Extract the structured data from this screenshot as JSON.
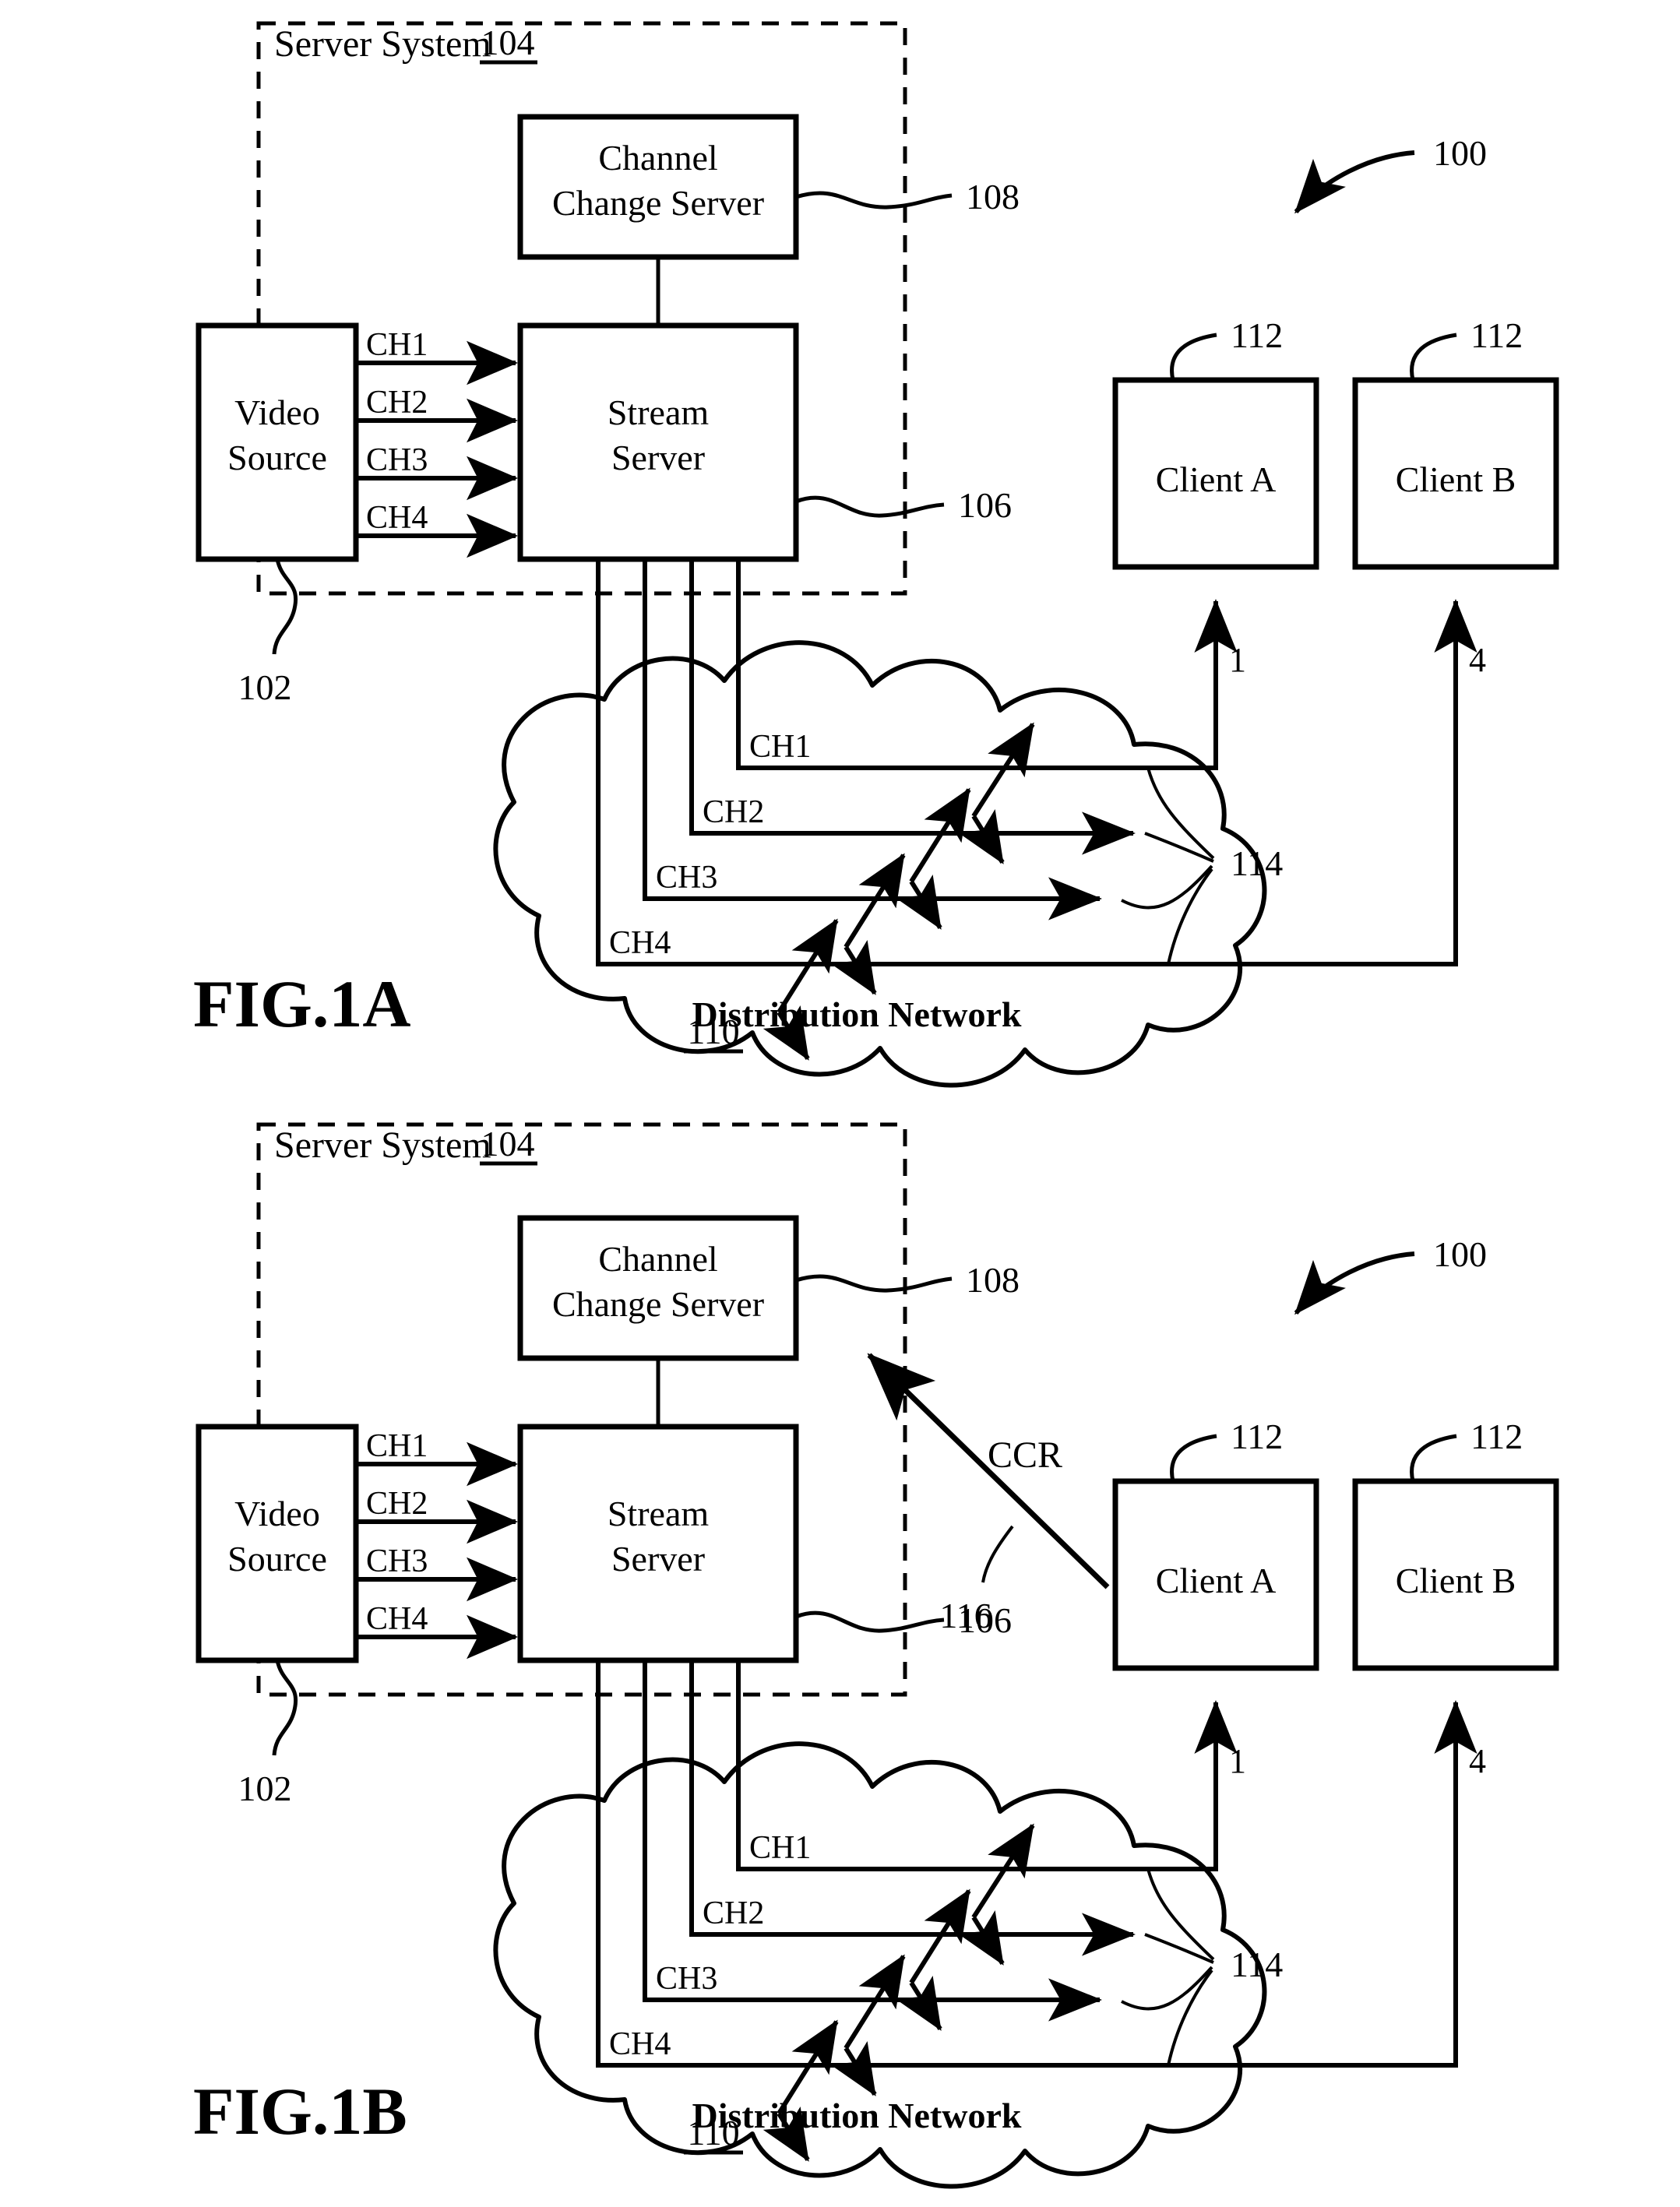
{
  "figures": [
    {
      "id": "fig1a",
      "caption": "FIG.1A",
      "system_ref": "100",
      "server_system": {
        "label": "Server System",
        "ref": "104",
        "channel_change_server": {
          "line1": "Channel",
          "line2": "Change Server",
          "ref": "108"
        },
        "stream_server": {
          "line1": "Stream",
          "line2": "Server",
          "ref": "106"
        }
      },
      "video_source": {
        "line1": "Video",
        "line2": "Source",
        "ref": "102"
      },
      "input_channels": [
        "CH1",
        "CH2",
        "CH3",
        "CH4"
      ],
      "network": {
        "label": "Distribution Network",
        "ref": "110",
        "stream_ref": "114",
        "channels": [
          "CH1",
          "CH2",
          "CH3",
          "CH4"
        ]
      },
      "clients": [
        {
          "label": "Client A",
          "ref": "112",
          "channel_number": "1"
        },
        {
          "label": "Client B",
          "ref": "112",
          "channel_number": "4"
        }
      ],
      "ccr": null
    },
    {
      "id": "fig1b",
      "caption": "FIG.1B",
      "system_ref": "100",
      "server_system": {
        "label": "Server System",
        "ref": "104",
        "channel_change_server": {
          "line1": "Channel",
          "line2": "Change Server",
          "ref": "108"
        },
        "stream_server": {
          "line1": "Stream",
          "line2": "Server",
          "ref": "106"
        }
      },
      "video_source": {
        "line1": "Video",
        "line2": "Source",
        "ref": "102"
      },
      "input_channels": [
        "CH1",
        "CH2",
        "CH3",
        "CH4"
      ],
      "network": {
        "label": "Distribution Network",
        "ref": "110",
        "stream_ref": "114",
        "channels": [
          "CH1",
          "CH2",
          "CH3",
          "CH4"
        ]
      },
      "clients": [
        {
          "label": "Client A",
          "ref": "112",
          "channel_number": "1"
        },
        {
          "label": "Client B",
          "ref": "112",
          "channel_number": "4"
        }
      ],
      "ccr": {
        "label": "CCR",
        "ref": "116"
      }
    }
  ],
  "style": {
    "ink": "#000000",
    "paper": "#ffffff"
  }
}
